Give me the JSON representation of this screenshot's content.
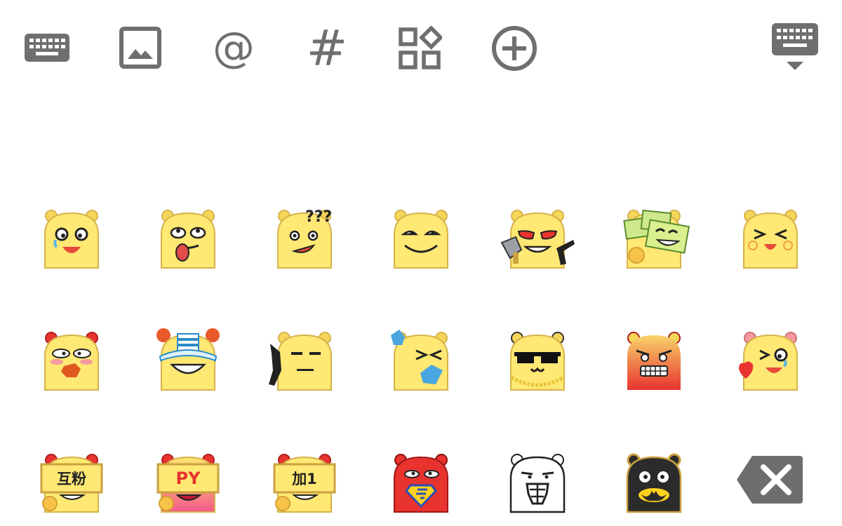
{
  "toolbar": {
    "icons": [
      "keyboard-icon",
      "image-icon",
      "at-icon",
      "hash-icon",
      "apps-icon",
      "add-circle-icon",
      "hide-keyboard-icon"
    ],
    "at_symbol": "@",
    "hash_symbol": "#"
  },
  "colors": {
    "icon_gray": "#6f6f6f",
    "face_yellow": "#ffe873",
    "face_outline": "#d6b24a",
    "ear_yellow": "#f6d65a",
    "red_face": "#e8332f",
    "black_face": "#2b2b2b",
    "backspace_gray": "#6d6d6d"
  },
  "emoji_rows": [
    [
      "laughing-tears",
      "tongue-out",
      "confused-question",
      "smug",
      "cleaver-and-gun",
      "money-cheer",
      "squint-laugh"
    ],
    [
      "angry-blush",
      "nurse-hat",
      "pistol-stare",
      "sweeping",
      "cool-sunglasses",
      "furious-red",
      "wink-heart"
    ],
    [
      "sign-hufen",
      "sign-py",
      "sign-jia1",
      "superman",
      "transformer",
      "batman"
    ]
  ],
  "signs": {
    "hufen": "互粉",
    "py": "PY",
    "jia1": "加1"
  },
  "question_marks": "???"
}
